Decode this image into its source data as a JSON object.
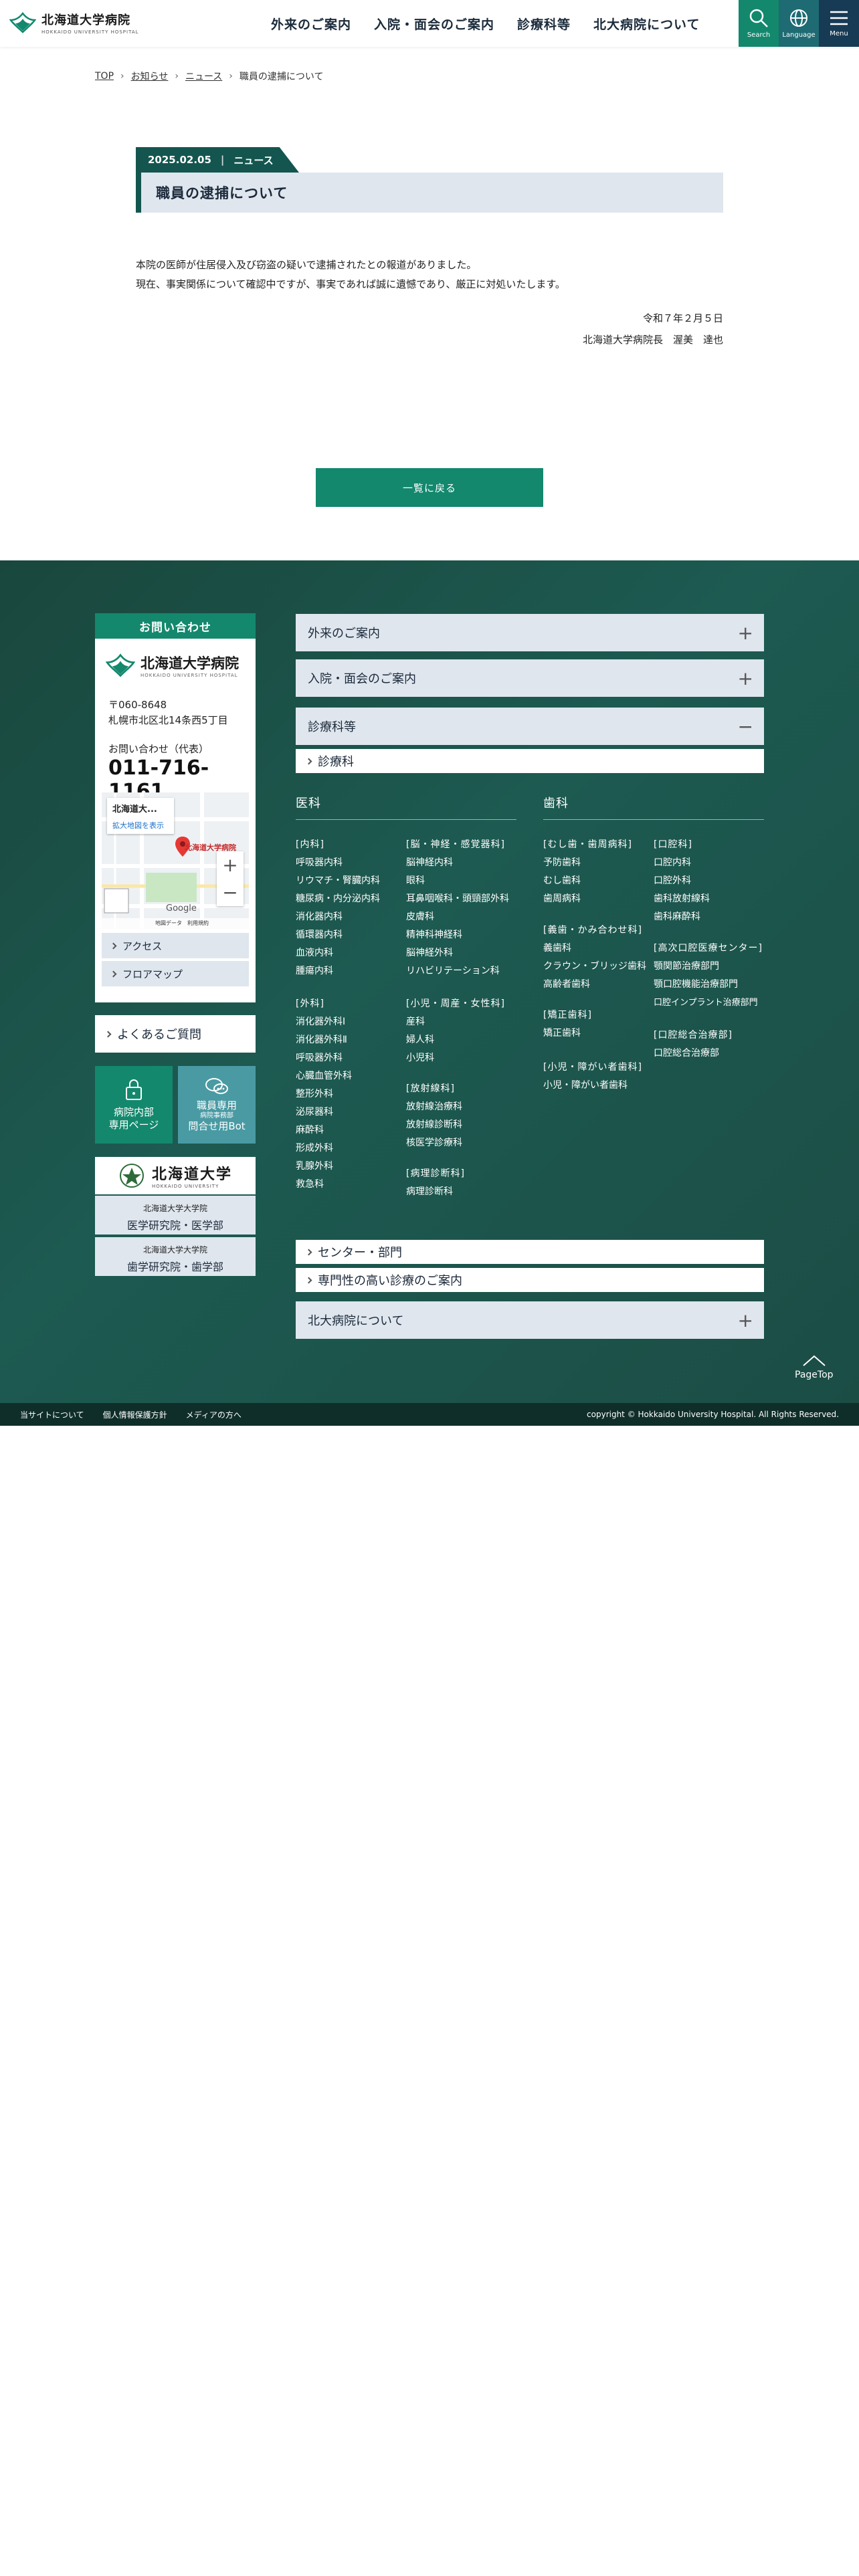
{
  "header": {
    "logo_jp": "北海道大学病院",
    "logo_en": "HOKKAIDO UNIVERSITY HOSPITAL",
    "nav": [
      "外来のご案内",
      "入院・面会のご案内",
      "診療科等",
      "北大病院について"
    ],
    "search_label": "Search",
    "language_label": "Language",
    "menu_label": "Menu"
  },
  "breadcrumb": [
    "TOP",
    "お知らせ",
    "ニュース",
    "職員の逮捕について"
  ],
  "article": {
    "date": "2025.02.05",
    "category": "ニュース",
    "title": "職員の逮捕について",
    "body": [
      "本院の医師が住居侵入及び窃盗の疑いで逮捕されたとの報道がありました。",
      "現在、事実関係について確認中ですが、事実であれば誠に遺憾であり、厳正に対処いたします。"
    ],
    "sign_date": "令和７年２月５日",
    "sign_name": "北海道大学病院長　渥美　達也",
    "back_label": "一覧に戻る"
  },
  "contact": {
    "heading": "お問い合わせ",
    "logo_jp": "北海道大学病院",
    "logo_en": "HOKKAIDO UNIVERSITY HOSPITAL",
    "postal": "〒060-8648",
    "address": "札幌市北区北14条西5丁目",
    "tel_label": "お問い合わせ（代表）",
    "tel": "011-716-1161",
    "map_title": "北海道大...",
    "map_link": "拡大地図を表示",
    "map_pin_label": "北海道大学病院",
    "map_google": "Google",
    "map_footer": "地図データ　利用規約",
    "links": [
      "アクセス",
      "フロアマップ"
    ]
  },
  "faq_label": "よくあるご質問",
  "staff_page": [
    "病院内部",
    "専用ページ"
  ],
  "staff_bot": [
    "職員専用",
    "病院事務部",
    "問合せ用Bot"
  ],
  "university": {
    "jp": "北海道大学",
    "en": "HOKKAIDO UNIVERSITY"
  },
  "grad_schools": [
    {
      "small": "北海道大学大学院",
      "large": "医学研究院・医学部"
    },
    {
      "small": "北海道大学大学院",
      "large": "歯学研究院・歯学部"
    }
  ],
  "sitemap": {
    "acc1": "外来のご案内",
    "acc2": "入院・面会のご案内",
    "acc3": "診療科等",
    "sub1": "診療科",
    "medical_title": "医科",
    "dental_title": "歯科",
    "med_col1": [
      {
        "head": "[内科]",
        "items": [
          "呼吸器内科",
          "リウマチ・腎臓内科",
          "糖尿病・内分泌内科",
          "消化器内科",
          "循環器内科",
          "血液内科",
          "腫瘍内科"
        ]
      },
      {
        "head": "[外科]",
        "items": [
          "消化器外科Ⅰ",
          "消化器外科Ⅱ",
          "呼吸器外科",
          "心臓血管外科",
          "整形外科",
          "泌尿器科",
          "麻酔科",
          "形成外科",
          "乳腺外科",
          "救急科"
        ]
      }
    ],
    "med_col2": [
      {
        "head": "[脳・神経・感覚器科]",
        "items": [
          "脳神経内科",
          "眼科",
          "耳鼻咽喉科・頭頸部外科",
          "皮膚科",
          "精神科神経科",
          "脳神経外科",
          "リハビリテーション科"
        ]
      },
      {
        "head": "[小児・周産・女性科]",
        "items": [
          "産科",
          "婦人科",
          "小児科"
        ]
      },
      {
        "head": "[放射線科]",
        "items": [
          "放射線治療科",
          "放射線診断科",
          "核医学診療科"
        ]
      },
      {
        "head": "[病理診断科]",
        "items": [
          "病理診断科"
        ]
      }
    ],
    "den_col1": [
      {
        "head": "[むし歯・歯周病科]",
        "items": [
          "予防歯科",
          "むし歯科",
          "歯周病科"
        ]
      },
      {
        "head": "[義歯・かみ合わせ科]",
        "items": [
          "義歯科",
          "クラウン・ブリッジ歯科",
          "高齢者歯科"
        ]
      },
      {
        "head": "[矯正歯科]",
        "items": [
          "矯正歯科"
        ]
      },
      {
        "head": "[小児・障がい者歯科]",
        "items": [
          "小児・障がい者歯科"
        ]
      }
    ],
    "den_col2": [
      {
        "head": "[口腔科]",
        "items": [
          "口腔内科",
          "口腔外科",
          "歯科放射線科",
          "歯科麻酔科"
        ]
      },
      {
        "head": "[高次口腔医療センター]",
        "items": [
          "顎関節治療部門",
          "顎口腔機能治療部門",
          "口腔インプラント治療部門"
        ]
      },
      {
        "head": "[口腔総合治療部]",
        "items": [
          "口腔総合治療部"
        ]
      }
    ],
    "sub2": "センター・部門",
    "sub3": "専門性の高い診療のご案内",
    "acc4": "北大病院について"
  },
  "pagetop_label": "PageTop",
  "bottom": {
    "links": [
      "当サイトについて",
      "個人情報保護方針",
      "メディアの方へ"
    ],
    "copyright": "copyright © Hokkaido University Hospital. All Rights Reserved."
  }
}
